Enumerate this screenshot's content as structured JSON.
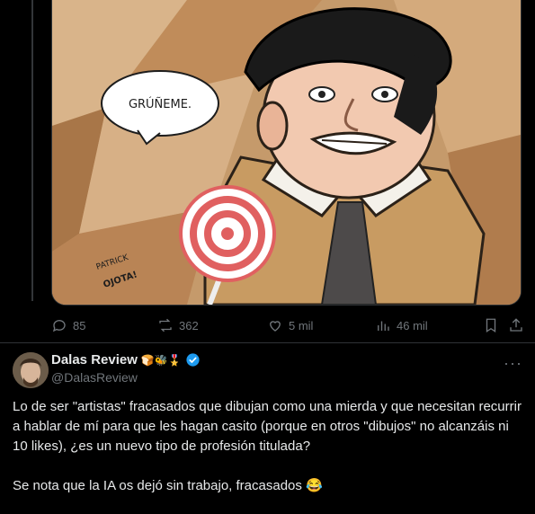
{
  "media": {
    "speech_bubble": "GRÚÑEME.",
    "signature_line1": "PATRICK",
    "signature_line2": "OJOTA!"
  },
  "actions": {
    "replies": "85",
    "reposts": "362",
    "likes": "5 mil",
    "views": "46 mil"
  },
  "reply": {
    "author_name": "Dalas Review",
    "author_badges": "🍞🐝🎖️",
    "author_handle": "@DalasReview",
    "paragraph1": "Lo de ser \"artistas\" fracasados que dibujan como una mierda y que necesitan recurrir a hablar de mí para que les hagan casito (porque en otros \"dibujos\" no alcanzáis ni 10 likes), ¿es un nuevo tipo de profesión titulada?",
    "paragraph2": "Se nota que la IA os dejó sin trabajo, fracasados 😂"
  },
  "colors": {
    "background": "#000000",
    "text": "#e7e9ea",
    "muted": "#71767b",
    "border": "#2f3336",
    "verified": "#1d9bf0"
  },
  "icons": [
    "reply-icon",
    "repost-icon",
    "like-icon",
    "views-icon",
    "bookmark-icon",
    "share-icon",
    "verified-icon",
    "more-icon"
  ]
}
